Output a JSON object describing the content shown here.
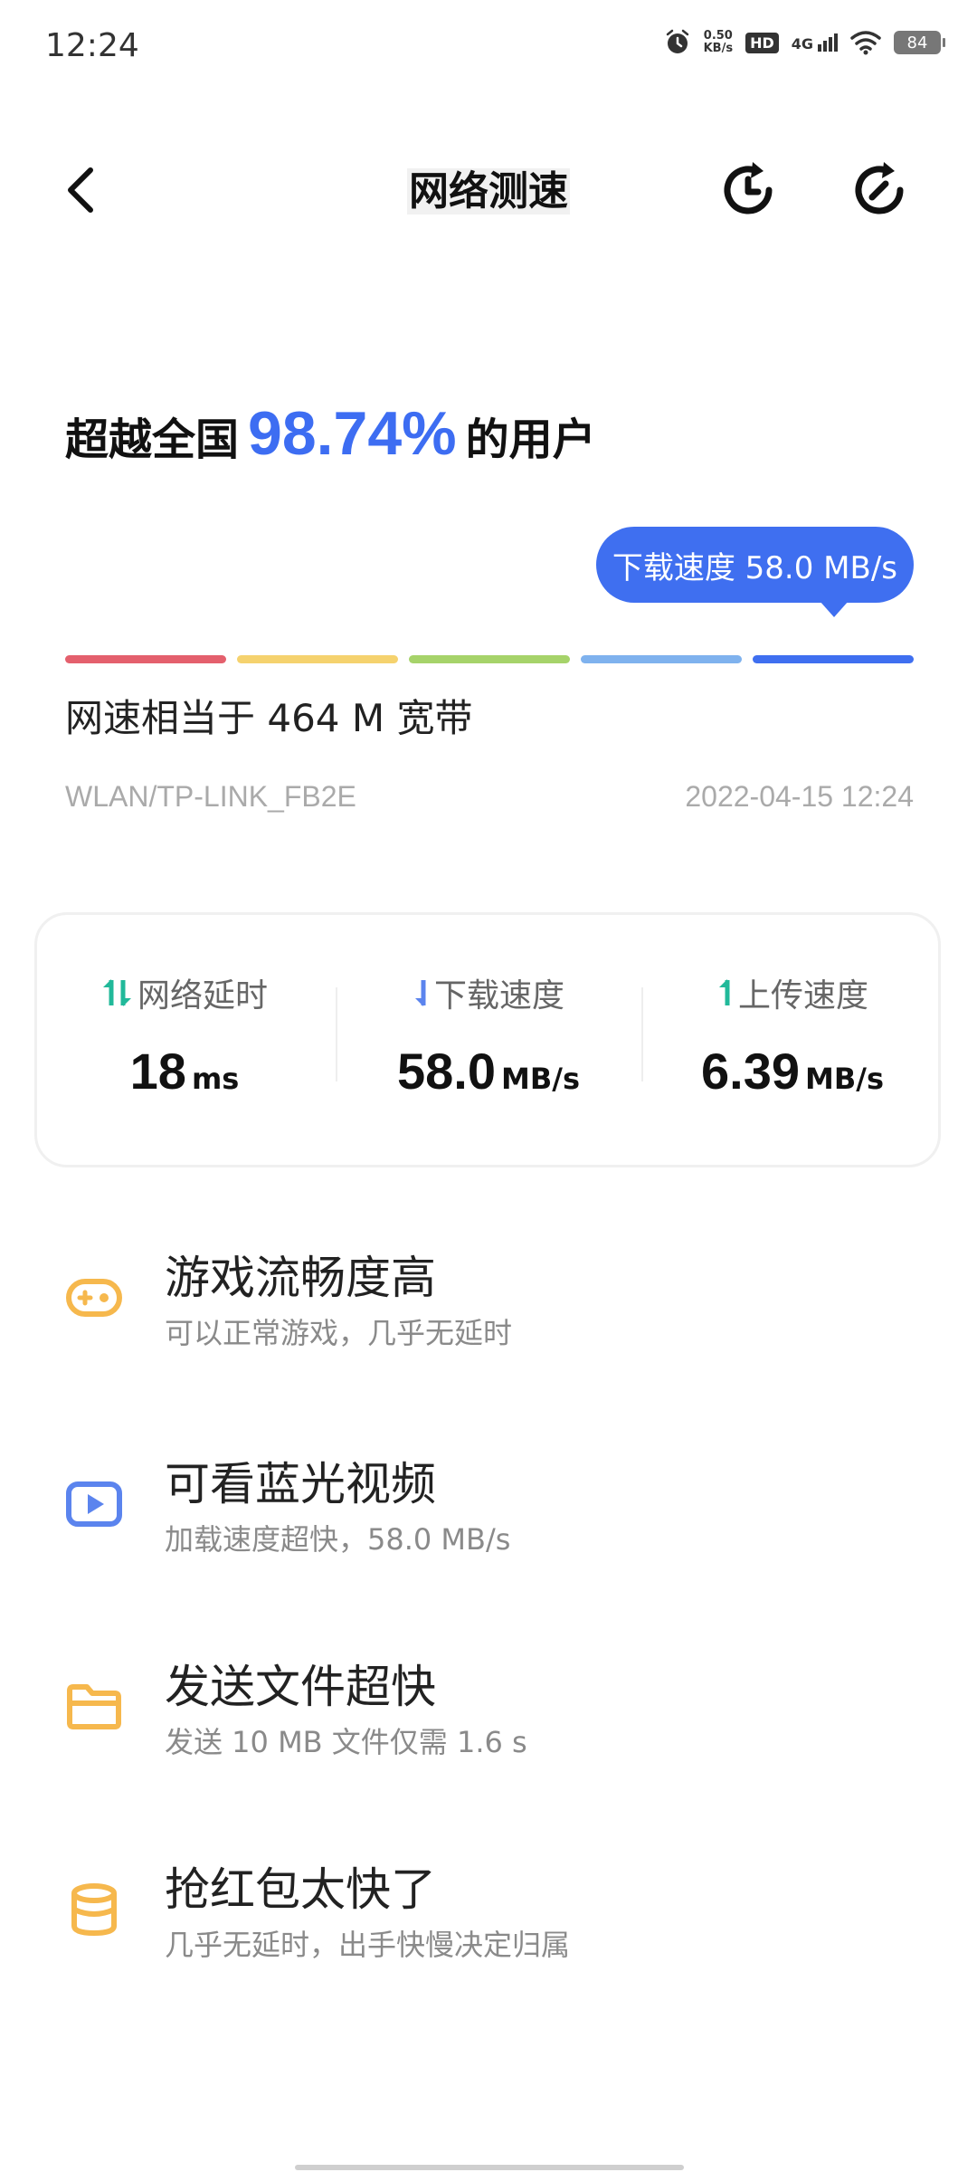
{
  "status_bar": {
    "time": "12:24",
    "net_speed_value": "0.50",
    "net_speed_unit": "KB/s",
    "hd_label": "HD",
    "network_label": "4G",
    "battery": "84"
  },
  "header": {
    "title": "网络测速"
  },
  "summary": {
    "prefix": "超越全国",
    "percent": "98.74%",
    "suffix": "的用户",
    "bubble_text": "下载速度 58.0 MB/s",
    "equivalent": "网速相当于 464 M 宽带",
    "network_name": "WLAN/TP-LINK_FB2E",
    "test_time": "2022-04-15 12:24"
  },
  "scale_colors": [
    "#e4606d",
    "#f5d26e",
    "#a6d36a",
    "#7fb2ee",
    "#3f6ff0"
  ],
  "stats": {
    "latency": {
      "label": "网络延时",
      "value": "18",
      "unit": "ms"
    },
    "download": {
      "label": "下载速度",
      "value": "58.0",
      "unit": "MB/s"
    },
    "upload": {
      "label": "上传速度",
      "value": "6.39",
      "unit": "MB/s"
    }
  },
  "features": [
    {
      "icon": "gamepad-icon",
      "title": "游戏流畅度高",
      "desc": "可以正常游戏，几乎无延时",
      "color": "#f6b84d"
    },
    {
      "icon": "play-video-icon",
      "title": "可看蓝光视频",
      "desc": "加载速度超快，58.0 MB/s",
      "color": "#5b84ee"
    },
    {
      "icon": "folder-icon",
      "title": "发送文件超快",
      "desc": "发送 10 MB 文件仅需 1.6 s",
      "color": "#f6b84d"
    },
    {
      "icon": "red-packet-icon",
      "title": "抢红包太快了",
      "desc": "几乎无延时，出手快慢决定归属",
      "color": "#f6b84d"
    }
  ],
  "colors": {
    "accent": "#3f6ff0",
    "teal": "#21b99a",
    "feature_yellow": "#f6b84d",
    "feature_blue": "#5b84ee"
  }
}
